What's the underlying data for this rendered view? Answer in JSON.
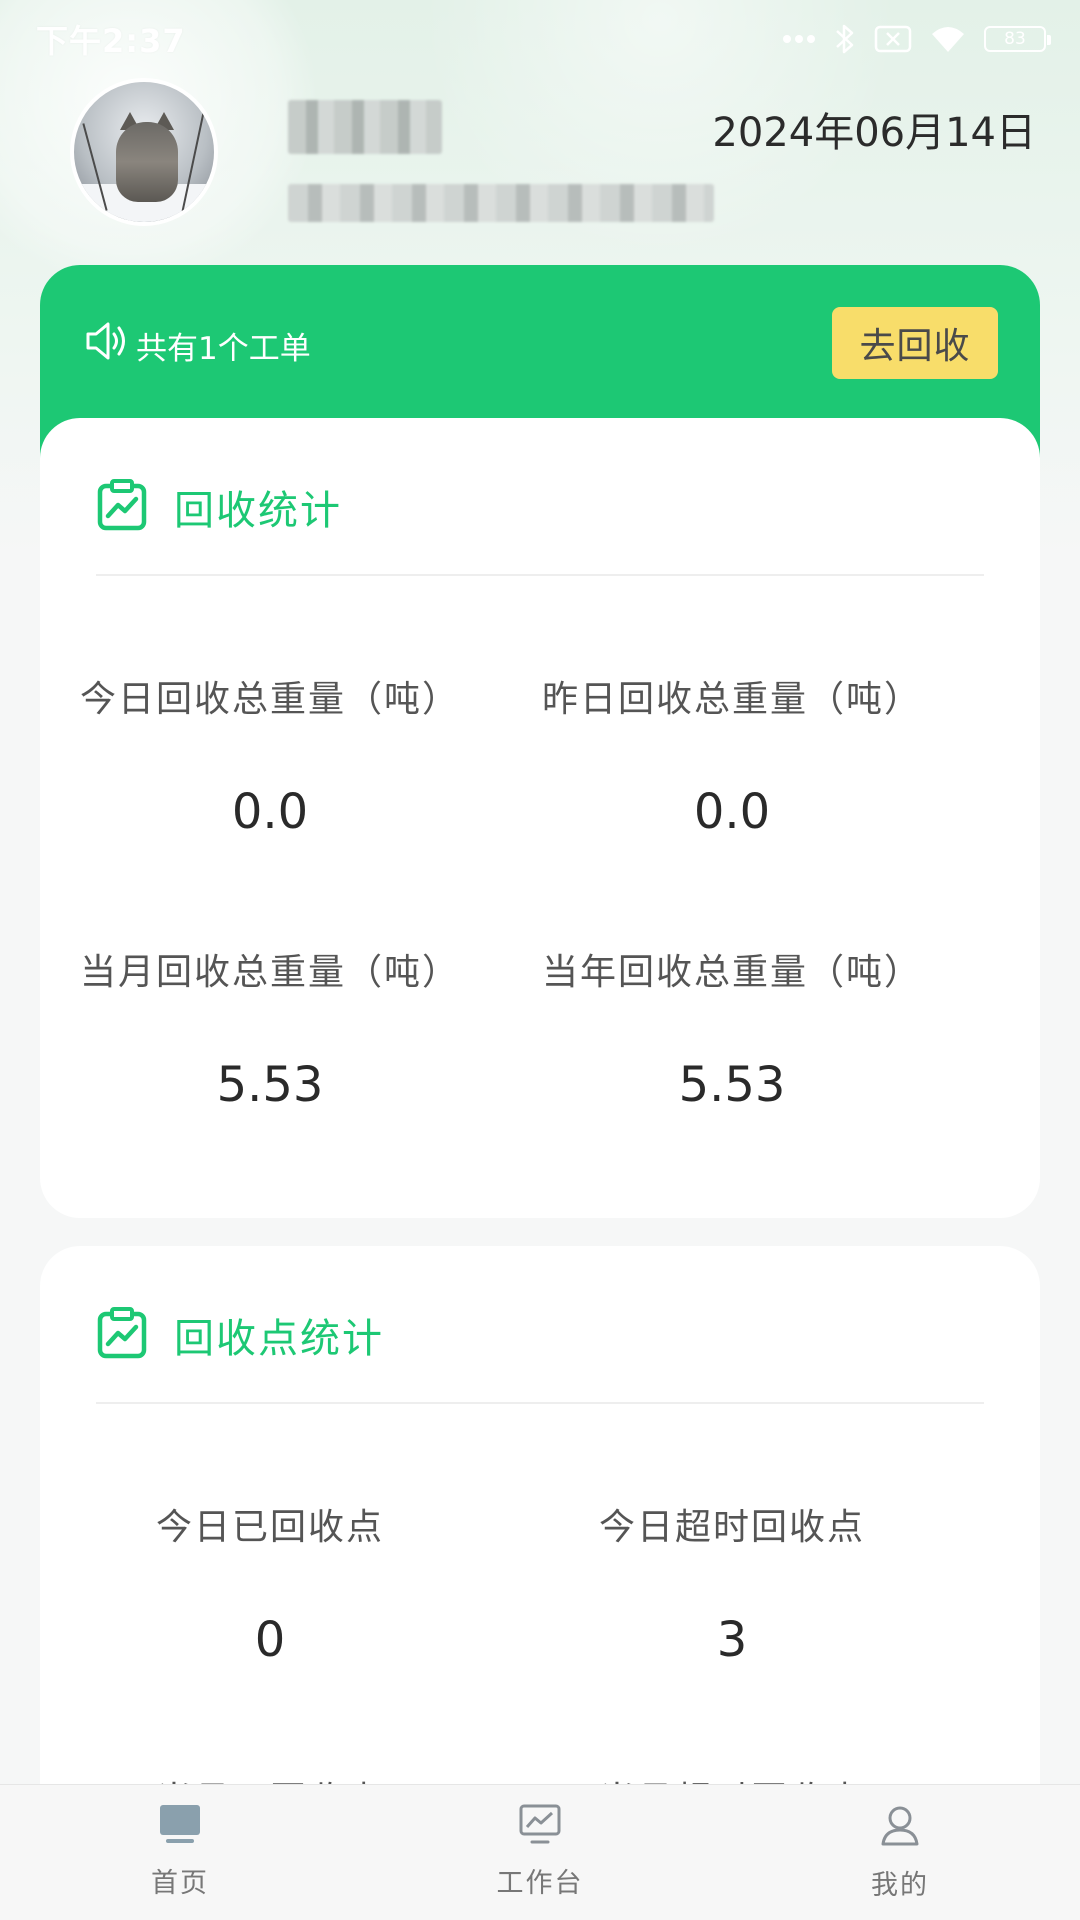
{
  "status_bar": {
    "time": "下午2:37",
    "battery": "83"
  },
  "profile": {
    "date": "2024年06月14日"
  },
  "banner": {
    "notice": "共有1个工单",
    "go_button": "去回收"
  },
  "recycle_stats": {
    "title": "回收统计",
    "items": [
      {
        "label": "今日回收总重量（吨）",
        "value": "0.0"
      },
      {
        "label": "昨日回收总重量（吨）",
        "value": "0.0"
      },
      {
        "label": "当月回收总重量（吨）",
        "value": "5.53"
      },
      {
        "label": "当年回收总重量（吨）",
        "value": "5.53"
      }
    ]
  },
  "point_stats": {
    "title": "回收点统计",
    "items": [
      {
        "label": "今日已回收点",
        "value": "0"
      },
      {
        "label": "今日超时回收点",
        "value": "3"
      },
      {
        "label": "当月已回收点",
        "value": ""
      },
      {
        "label": "当月超时回收点",
        "value": ""
      }
    ]
  },
  "bottom_nav": {
    "items": [
      {
        "label": "首页",
        "icon": "monitor-icon"
      },
      {
        "label": "工作台",
        "icon": "chart-board-icon"
      },
      {
        "label": "我的",
        "icon": "user-icon"
      }
    ]
  },
  "colors": {
    "accent": "#1dc874",
    "button_yellow": "#f8dd6a"
  }
}
